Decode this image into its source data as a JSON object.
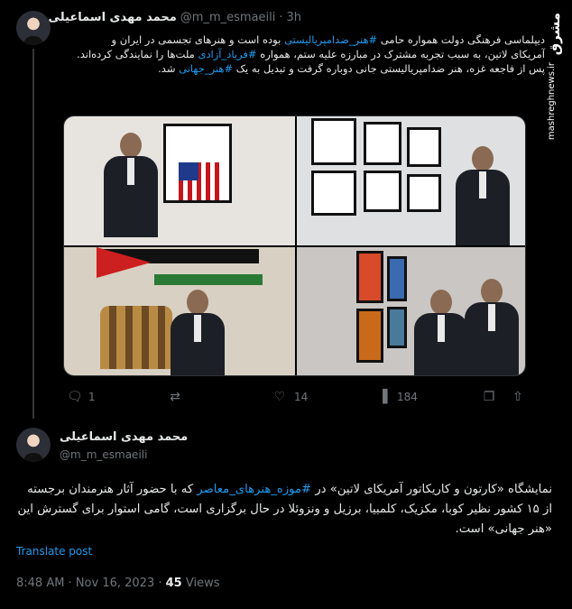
{
  "tweet1": {
    "name": "محمد مهدی اسماعیلی",
    "handle": "@m_m_esmaeili",
    "dot": "·",
    "time": "3h",
    "text_parts": [
      "دیپلماسی فرهنگی دولت همواره حامی ",
      "#هنر_ضدامپریالیستی",
      " بوده است و هنرهای تجسمی در ایران و آمریکای لاتین، به سبب تجربه مشترک در مبارزه علیه ستم، همواره ",
      "#فریاد_آزادی",
      " ملت‌ها را نمایندگی کرده‌اند."
    ],
    "line2_parts": [
      "پس از فاجعه غزه، هنر ضدامپریالیستی جانی دوباره گرفت و تبدیل به یک ",
      "#هنر_جهانی",
      " شد."
    ],
    "actions": {
      "replies": "1",
      "likes": "14",
      "views": "184"
    },
    "icons": [
      "reply-icon",
      "retweet-icon",
      "like-icon",
      "views-icon",
      "bookmark-icon",
      "share-icon"
    ]
  },
  "tweet2": {
    "name": "محمد مهدی اسماعیلی",
    "handle": "@m_m_esmaeili",
    "text_parts": [
      "نمایشگاه «کارتون و کاریکاتور آمریکای لاتین» در ",
      "#موزه_هنرهای_معاصر",
      " که با حضور آثار هنرمندان برجسته از ۱۵ کشور نظیر کوبا، مکزیک، کلمبیا، برزیل و ونزوئلا در حال برگزاری است، گامی استوار برای گسترش این «هنر جهانی» است."
    ],
    "translate": "Translate post",
    "meta_time": "8:48 AM · Nov 16, 2023 · ",
    "views_count": "45",
    "views_label": " Views"
  },
  "watermark": {
    "logo": "مشرق",
    "url": "mashreghnews.ir"
  },
  "colors": {
    "link": "#1d9bf0",
    "muted": "#71767b",
    "text": "#e7e9ea",
    "background": "#000000"
  }
}
